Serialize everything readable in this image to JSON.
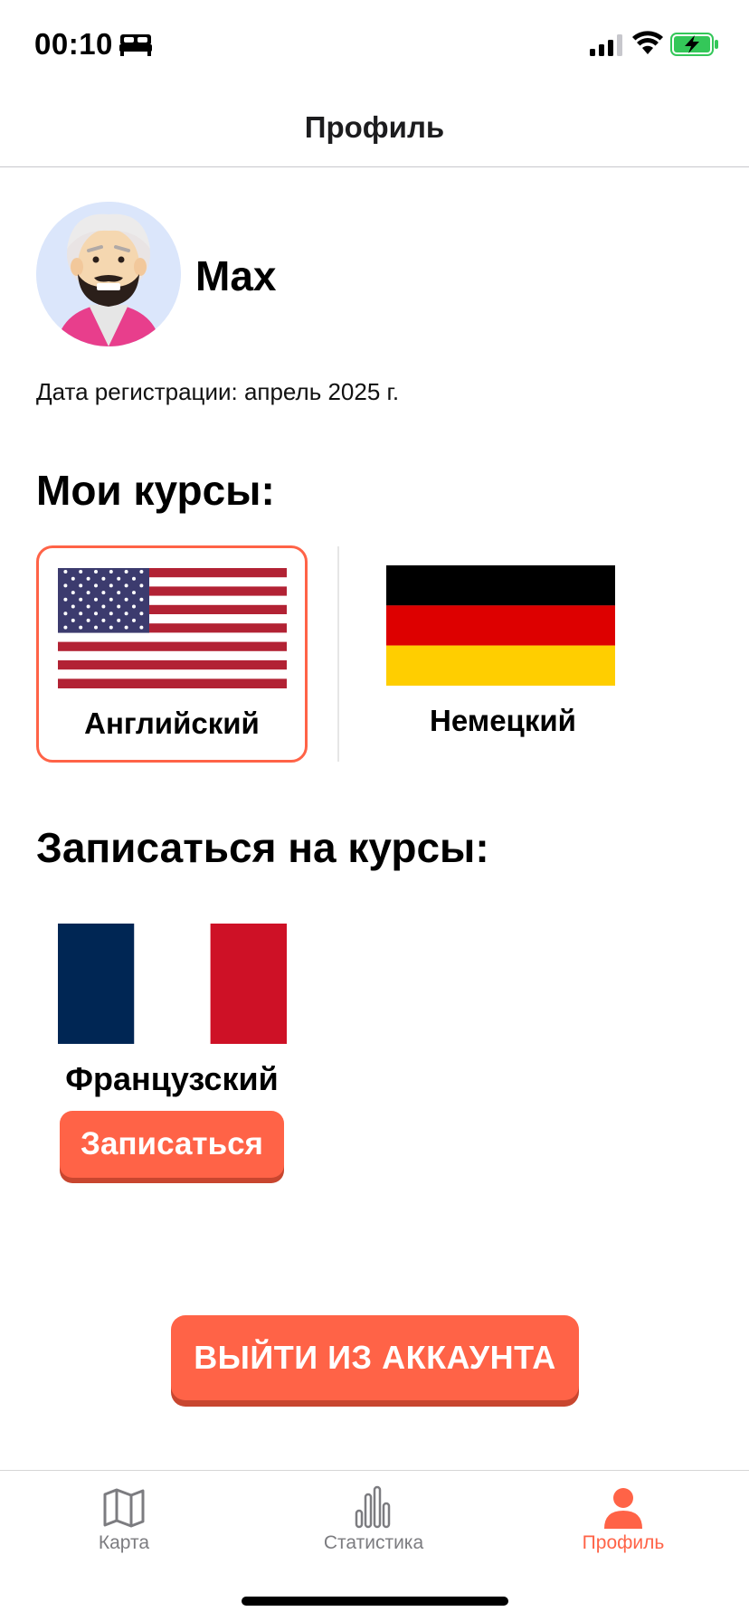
{
  "status_bar": {
    "time": "00:10",
    "icons": [
      "bed-icon",
      "cellular-signal-icon",
      "wifi-icon",
      "battery-charging-icon"
    ]
  },
  "header": {
    "title": "Профиль"
  },
  "profile": {
    "name": "Max",
    "avatar_icon": "bearded-man-avatar",
    "registration_text": "Дата регистрации: апрель 2025 г."
  },
  "my_courses": {
    "title": "Мои курсы:",
    "items": [
      {
        "label": "Английский",
        "flag": "us-flag",
        "selected": true
      },
      {
        "label": "Немецкий",
        "flag": "germany-flag",
        "selected": false
      }
    ]
  },
  "enroll": {
    "title": "Записаться на курсы:",
    "items": [
      {
        "label": "Французский",
        "flag": "france-flag",
        "button_label": "Записаться"
      }
    ]
  },
  "logout_label": "ВЫЙТИ ИЗ АККАУНТА",
  "tabs": [
    {
      "label": "Карта",
      "icon": "map-icon",
      "active": false
    },
    {
      "label": "Статистика",
      "icon": "bar-chart-icon",
      "active": false
    },
    {
      "label": "Профиль",
      "icon": "person-icon",
      "active": true
    }
  ],
  "colors": {
    "accent": "#ff6347",
    "accent_shadow": "#c8462f",
    "inactive_tab": "#7c7c80",
    "battery_green": "#34c759"
  }
}
